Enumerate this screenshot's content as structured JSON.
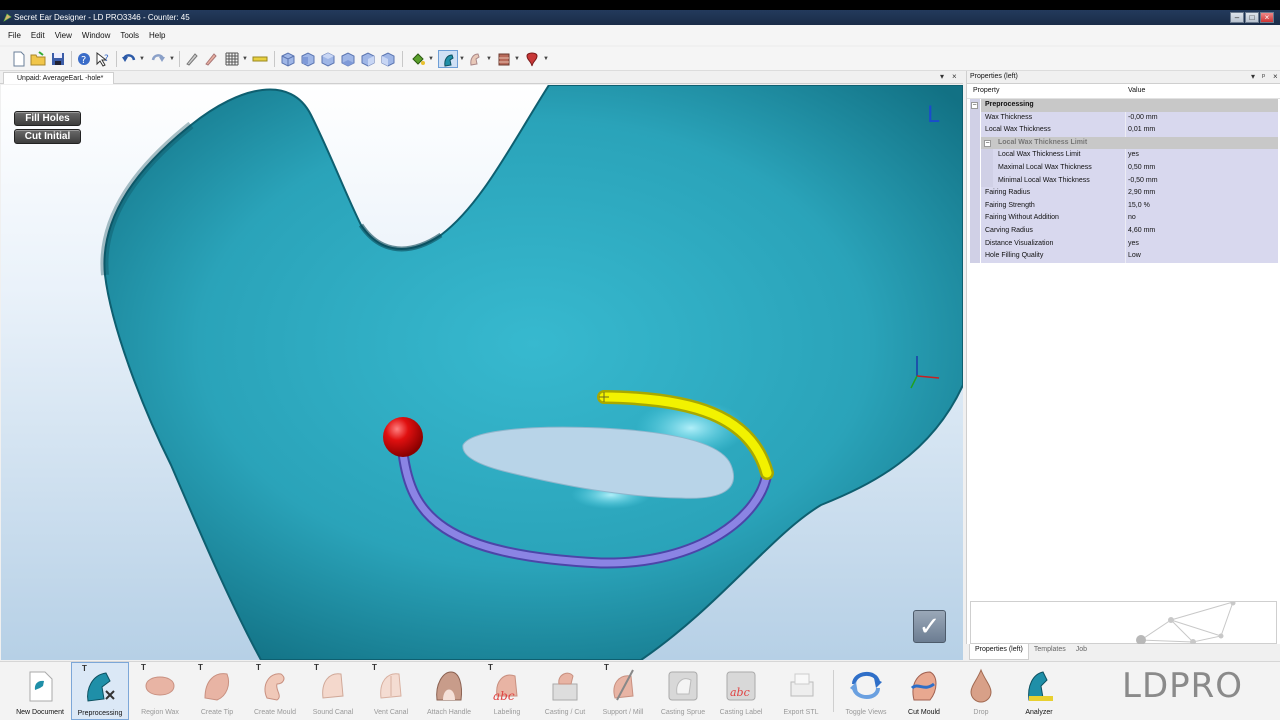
{
  "window": {
    "title": "Secret Ear Designer - LD PRO3346 - Counter: 45"
  },
  "menu": [
    "File",
    "Edit",
    "View",
    "Window",
    "Tools",
    "Help"
  ],
  "document_tab": {
    "label": "Unpaid: AverageEarL -hole*"
  },
  "viewport": {
    "buttons": {
      "fill_holes": "Fill Holes",
      "cut_initial": "Cut Initial"
    },
    "view_label": "L",
    "confirm_glyph": "✓",
    "colors": {
      "mesh": "#2aa8bd",
      "hole": "#b6d0e6",
      "red_marker": "#dd1111",
      "yellow_path": "#f0f000",
      "blue_path": "#7a72d8"
    }
  },
  "properties": {
    "panel_title": "Properties (left)",
    "col_property": "Property",
    "col_value": "Value",
    "category": "Preprocessing",
    "rows_top": [
      {
        "name": "Wax Thickness",
        "value": "-0,00 mm"
      },
      {
        "name": "Local Wax Thickness",
        "value": "0,01 mm"
      }
    ],
    "subcategory": "Local Wax Thickness Limit",
    "rows_sub": [
      {
        "name": "Local Wax Thickness Limit",
        "value": "yes"
      },
      {
        "name": "Maximal Local Wax Thickness",
        "value": "0,50 mm"
      },
      {
        "name": "Minimal Local Wax Thickness",
        "value": "-0,50 mm"
      }
    ],
    "rows_bottom": [
      {
        "name": "Fairing Radius",
        "value": "2,90 mm"
      },
      {
        "name": "Fairing Strength",
        "value": "15,0 %"
      },
      {
        "name": "Fairing Without Addition",
        "value": "no"
      },
      {
        "name": "Carving Radius",
        "value": "4,60 mm"
      },
      {
        "name": "Distance Visualization",
        "value": "yes"
      },
      {
        "name": "Hole Filling Quality",
        "value": "Low"
      }
    ],
    "tabs": [
      "Properties (left)",
      "Templates",
      "Job"
    ]
  },
  "shelf": {
    "tools": [
      {
        "label": "New Document",
        "active": true
      },
      {
        "label": "Preprocessing",
        "active": true,
        "selected": true
      },
      {
        "label": "Region Wax",
        "active": false
      },
      {
        "label": "Create Tip",
        "active": false
      },
      {
        "label": "Create Mould",
        "active": false
      },
      {
        "label": "Sound Canal",
        "active": false
      },
      {
        "label": "Vent Canal",
        "active": false
      },
      {
        "label": "Attach Handle",
        "active": false
      },
      {
        "label": "Labeling",
        "active": false
      },
      {
        "label": "Casting / Cut",
        "active": false
      },
      {
        "label": "Support / Mill",
        "active": false
      },
      {
        "label": "Casting Sprue",
        "active": false
      },
      {
        "label": "Casting Label",
        "active": false
      },
      {
        "label": "Export STL",
        "active": false
      },
      {
        "label": "Toggle Views",
        "active": false
      },
      {
        "label": "Cut Mould",
        "active": true
      },
      {
        "label": "Drop",
        "active": false
      },
      {
        "label": "Analyzer",
        "active": true
      }
    ],
    "t_marker": "T",
    "labeling_text": "abc"
  },
  "logo": "LDPRO"
}
